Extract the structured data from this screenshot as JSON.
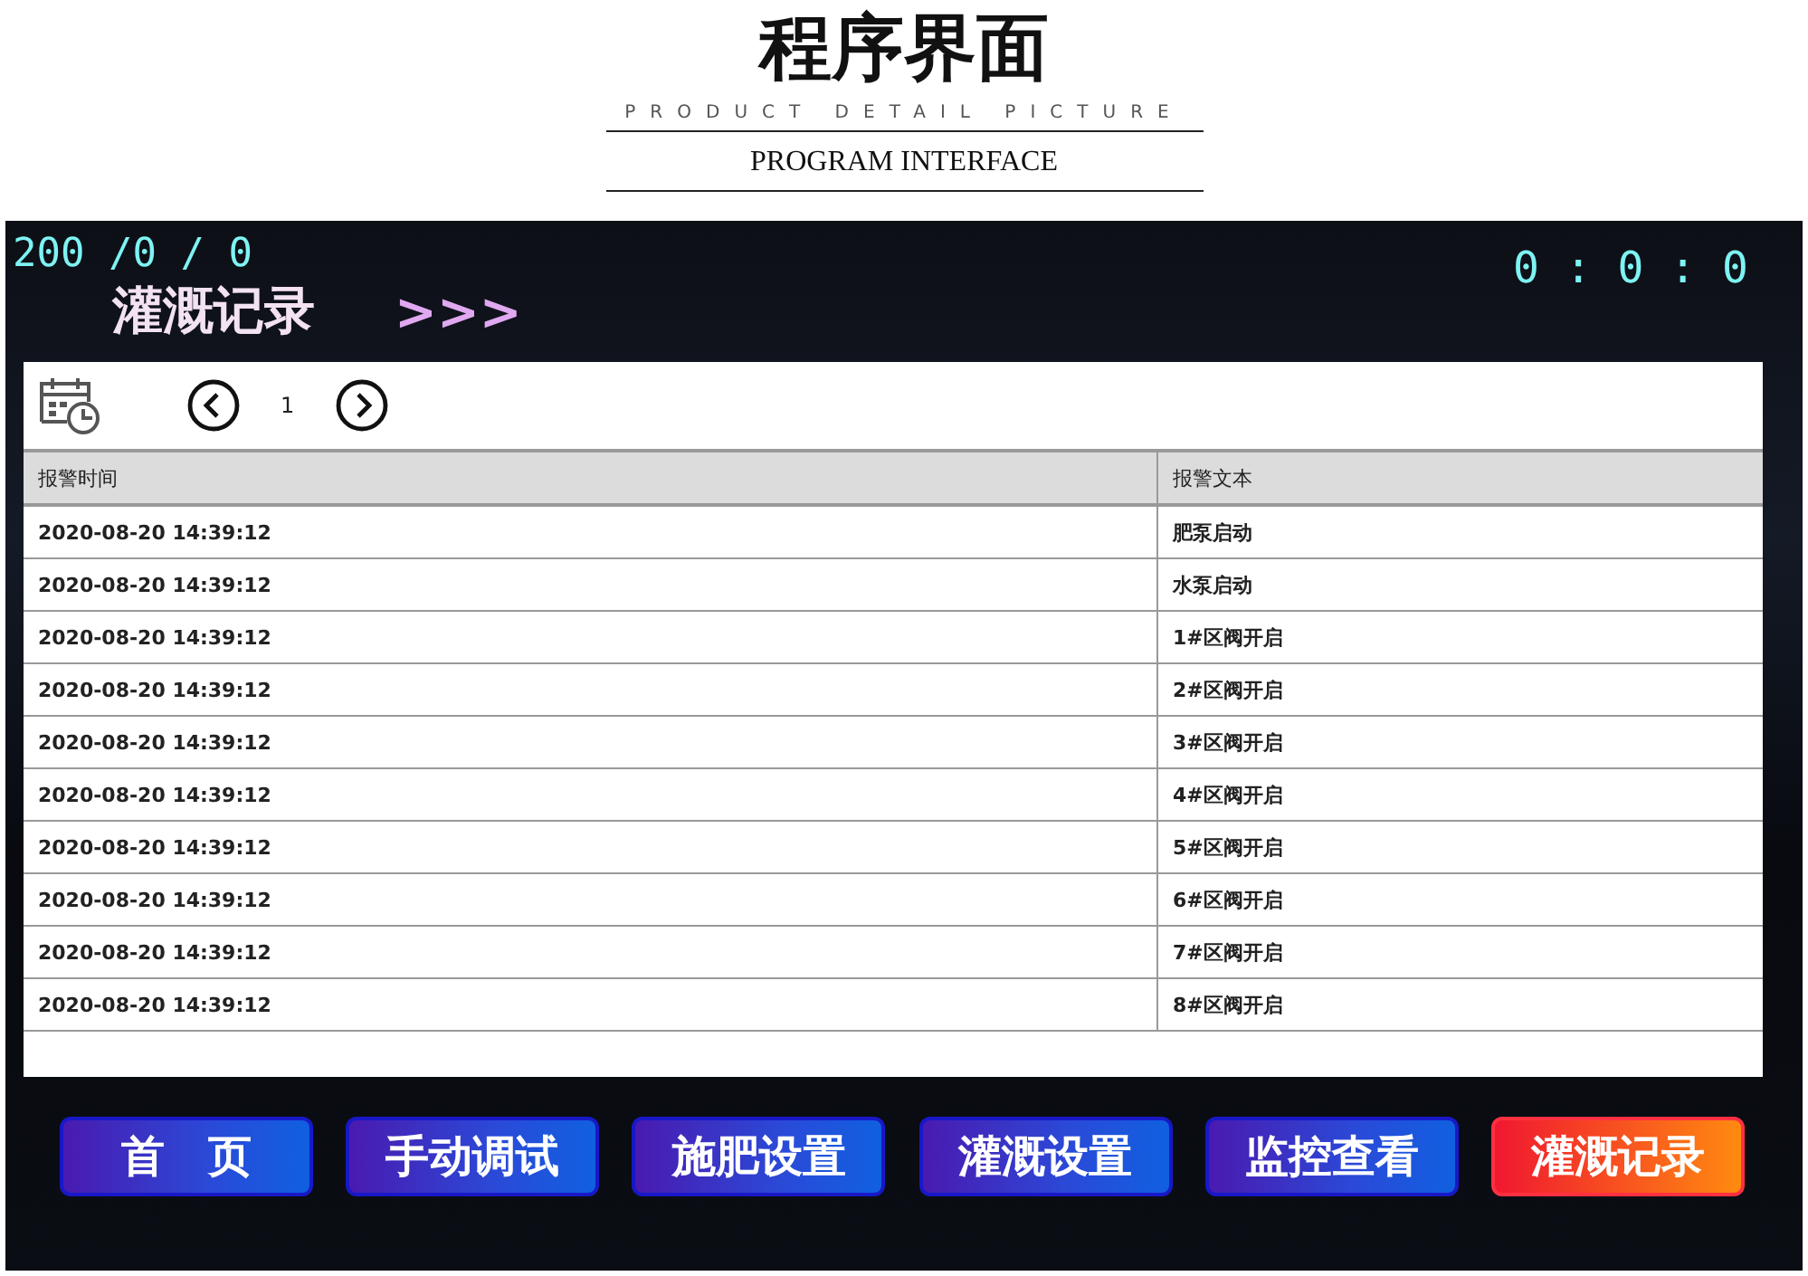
{
  "page_header": {
    "title": "程序界面",
    "subtitle": "PRODUCT DETAIL PICTURE",
    "section": "PROGRAM INTERFACE"
  },
  "screen": {
    "date": "200 /0 / 0",
    "time": "0 : 0 : 0",
    "title": "灌溉记录",
    "arrows": ">>>",
    "pager": {
      "page": "1"
    },
    "table": {
      "columns": [
        "报警时间",
        "报警文本"
      ],
      "rows": [
        [
          "2020-08-20 14:39:12",
          "肥泵启动"
        ],
        [
          "2020-08-20 14:39:12",
          "水泵启动"
        ],
        [
          "2020-08-20 14:39:12",
          "1#区阀开启"
        ],
        [
          "2020-08-20 14:39:12",
          "2#区阀开启"
        ],
        [
          "2020-08-20 14:39:12",
          "3#区阀开启"
        ],
        [
          "2020-08-20 14:39:12",
          "4#区阀开启"
        ],
        [
          "2020-08-20 14:39:12",
          "5#区阀开启"
        ],
        [
          "2020-08-20 14:39:12",
          "6#区阀开启"
        ],
        [
          "2020-08-20 14:39:12",
          "7#区阀开启"
        ],
        [
          "2020-08-20 14:39:12",
          "8#区阀开启"
        ]
      ]
    },
    "nav": [
      {
        "label": "首　页",
        "selected": false
      },
      {
        "label": "手动调试",
        "selected": false
      },
      {
        "label": "施肥设置",
        "selected": false
      },
      {
        "label": "灌溉设置",
        "selected": false
      },
      {
        "label": "监控查看",
        "selected": false
      },
      {
        "label": "灌溉记录",
        "selected": true
      }
    ]
  }
}
